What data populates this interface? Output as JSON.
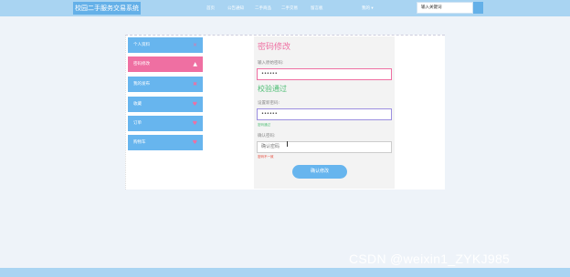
{
  "header": {
    "logo": "校园二手服务交易系统",
    "nav": [
      "首页",
      "公告通知",
      "二手商品",
      "二手交易",
      "留言板"
    ],
    "profile": "我的 ▾",
    "search_placeholder": "输入关键词"
  },
  "sidebar": {
    "items": [
      {
        "label": "个人资料",
        "icon": "×"
      },
      {
        "label": "密码修改",
        "icon": "▲"
      },
      {
        "label": "我的发布",
        "icon": "✖"
      },
      {
        "label": "收藏",
        "icon": "♥"
      },
      {
        "label": "订单",
        "icon": "♥"
      },
      {
        "label": "购物车",
        "icon": "♥"
      }
    ]
  },
  "form": {
    "title": "密码修改",
    "original_label": "输入原始密码:",
    "original_value": "••••••",
    "verify_text": "校验通过",
    "new_label": "设置新密码:",
    "new_value": "••••••",
    "new_hint": "密码通过",
    "confirm_label": "确认密码:",
    "confirm_placeholder": "确认密码",
    "confirm_hint": "密码不一致",
    "submit": "确认修改"
  },
  "watermark": "CSDN @weixin1_ZYKJ985",
  "colors": {
    "accent": "#67b5ee",
    "active": "#ef6fa2",
    "success": "#4dbd74",
    "error": "#e74c3c"
  }
}
